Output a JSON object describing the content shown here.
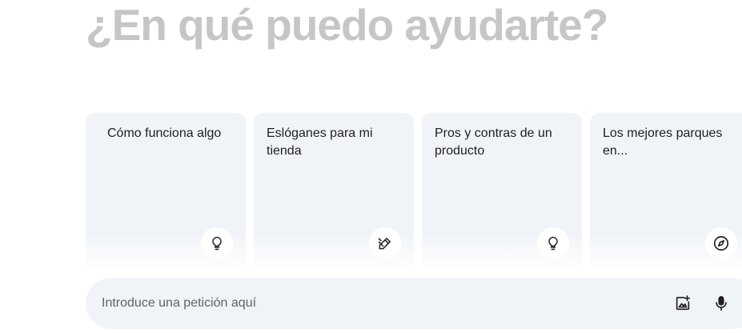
{
  "greeting": "¿En qué puedo ayudarte?",
  "cards": [
    {
      "label": "Cómo funciona algo",
      "icon": "lightbulb-icon"
    },
    {
      "label": "Eslóganes para mi tienda",
      "icon": "edit-sparkle-icon"
    },
    {
      "label": "Pros y contras de un producto",
      "icon": "lightbulb-icon"
    },
    {
      "label": "Los mejores parques en...",
      "icon": "compass-icon"
    }
  ],
  "prompt": {
    "placeholder": "Introduce una petición aquí",
    "value": ""
  },
  "toolbar": {
    "image_icon": "add-image-icon",
    "mic_icon": "microphone-icon"
  },
  "colors": {
    "greeting": "#c4c7c5",
    "card_bg": "#f0f4f9",
    "icon": "#1f1f1f"
  }
}
